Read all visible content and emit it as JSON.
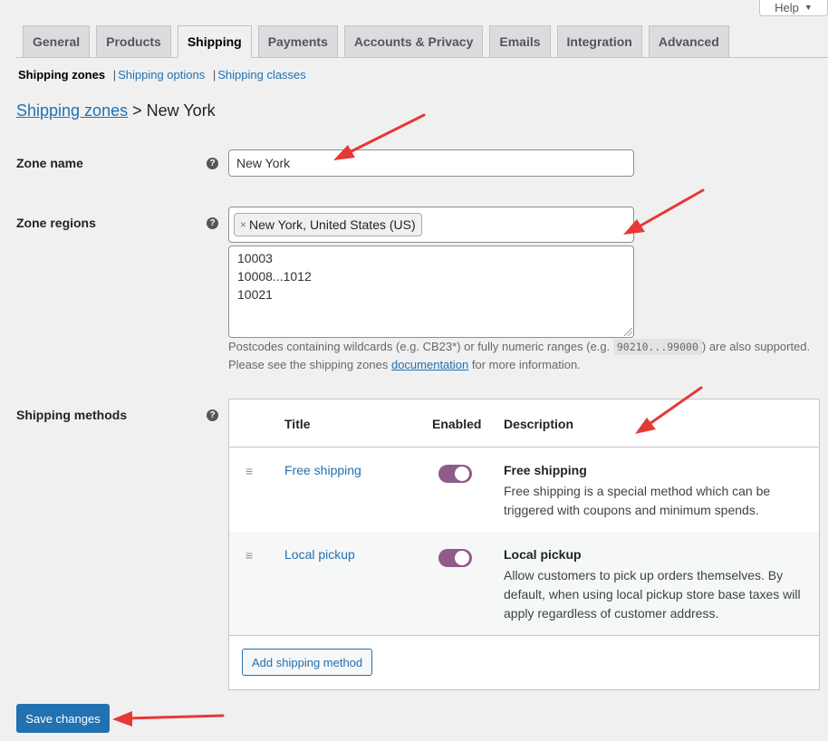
{
  "help_button": {
    "label": "Help",
    "icon": "caret-down-icon"
  },
  "tabs": [
    {
      "label": "General",
      "active": false
    },
    {
      "label": "Products",
      "active": false
    },
    {
      "label": "Shipping",
      "active": true
    },
    {
      "label": "Payments",
      "active": false
    },
    {
      "label": "Accounts & Privacy",
      "active": false
    },
    {
      "label": "Emails",
      "active": false
    },
    {
      "label": "Integration",
      "active": false
    },
    {
      "label": "Advanced",
      "active": false
    }
  ],
  "subnav": {
    "current": "Shipping zones",
    "links": [
      "Shipping options",
      "Shipping classes"
    ],
    "separator": "|"
  },
  "breadcrumb": {
    "parent": "Shipping zones",
    "separator": ">",
    "current": "New York"
  },
  "zone_name": {
    "label": "Zone name",
    "value": "New York",
    "help_icon": "question-circle-icon"
  },
  "zone_regions": {
    "label": "Zone regions",
    "selected": [
      "New York, United States (US)"
    ],
    "remove_glyph": "×",
    "postcodes": [
      "10003",
      "10008...1012",
      "10021"
    ],
    "help_text_before": "Postcodes containing wildcards (e.g. CB23*) or fully numeric ranges (e.g. ",
    "help_code": "90210...99000",
    "help_text_after": ") are also supported.",
    "help_line2_before": "Please see the shipping zones ",
    "help_link": "documentation",
    "help_line2_after": " for more information."
  },
  "shipping_methods": {
    "label": "Shipping methods",
    "columns": {
      "title": "Title",
      "enabled": "Enabled",
      "description": "Description"
    },
    "rows": [
      {
        "title": "Free shipping",
        "enabled": true,
        "desc_name": "Free shipping",
        "desc_text": "Free shipping is a special method which can be triggered with coupons and minimum spends."
      },
      {
        "title": "Local pickup",
        "enabled": true,
        "desc_name": "Local pickup",
        "desc_text": "Allow customers to pick up orders themselves. By default, when using local pickup store base taxes will apply regardless of customer address."
      }
    ],
    "add_button": "Add shipping method"
  },
  "save_button": "Save changes",
  "colors": {
    "primary": "#2271b1",
    "toggle_on": "#8e5b8b",
    "annotation_arrow": "#e53935"
  }
}
